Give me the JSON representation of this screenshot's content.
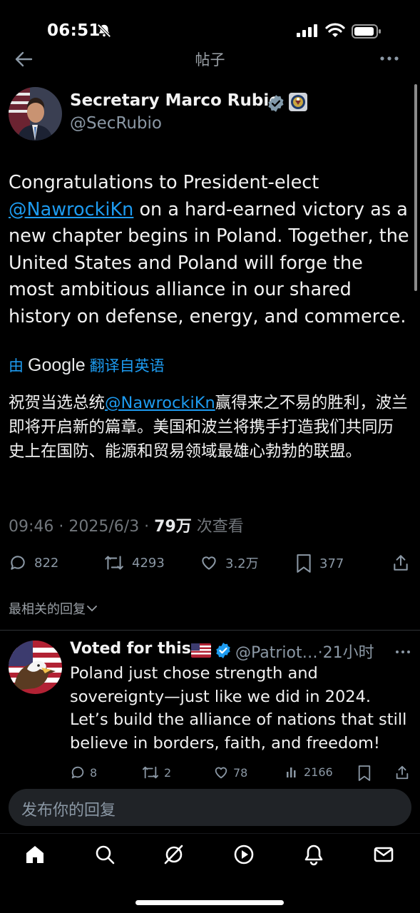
{
  "status_bar": {
    "time": "06:51"
  },
  "header": {
    "title": "帖子"
  },
  "post": {
    "author": "Secretary Marco Rubio",
    "handle": "@SecRubio",
    "text_parts": {
      "p1": "Congratulations to President-elect ",
      "mention": "@NawrockiKn",
      "p2": " on a hard-earned victory as a new chapter begins in Poland. Together, the United States and Poland will forge the most ambitious alliance in our shared history on defense, energy, and commerce."
    },
    "translate": {
      "by": "由",
      "google": "Google",
      "label": "翻译自英语"
    },
    "translated_parts": {
      "p1": "祝贺当选总统",
      "mention": "@NawrockiKn",
      "p2": "赢得来之不易的胜利，波兰即将开启新的篇章。美国和波兰将携手打造我们共同历史上在国防、能源和贸易领域最雄心勃勃的联盟。"
    },
    "meta": {
      "time_date": "09:46 · 2025/6/3 · ",
      "views": "79万",
      "views_label": " 次查看"
    },
    "actions": {
      "replies": "822",
      "reposts": "4293",
      "likes": "3.2万",
      "bookmarks": "377"
    }
  },
  "sort": {
    "label": "最相关的回复"
  },
  "reply": {
    "name": "Voted for this",
    "handle_time": "@Patriot…·21小时",
    "text": "Poland just chose strength and sovereignty—just like we did in 2024. Let’s build the alliance of nations that still believe in borders, faith, and freedom!",
    "actions": {
      "replies": "8",
      "reposts": "2",
      "likes": "78",
      "views": "2166"
    }
  },
  "composer": {
    "placeholder": "发布你的回复"
  },
  "colors": {
    "accent": "#1d9bf0",
    "background": "#000000",
    "muted": "#71767b"
  },
  "icons": [
    "back-arrow-icon",
    "more-icon",
    "verified-icon",
    "seal-icon",
    "reply-icon",
    "repost-icon",
    "like-icon",
    "bookmark-icon",
    "share-icon",
    "views-icon",
    "home-icon",
    "search-icon",
    "grok-icon",
    "video-icon",
    "notifications-icon",
    "messages-icon"
  ]
}
